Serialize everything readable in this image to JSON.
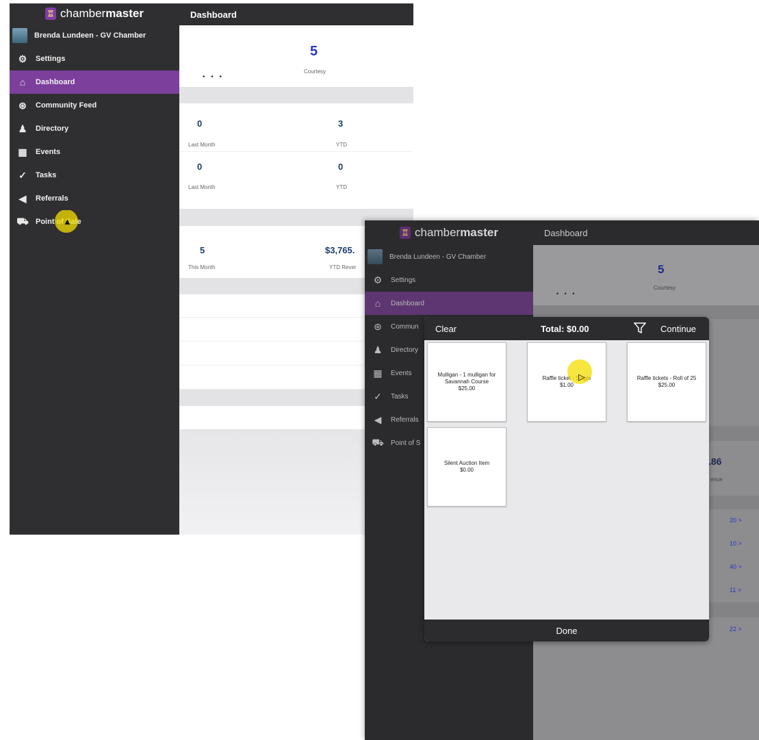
{
  "app": {
    "logo_text_a": "chamber",
    "logo_text_b": "master",
    "logo_glyph": "♖",
    "header_title": "Dashboard"
  },
  "sidebar": {
    "user": "Brenda Lundeen - GV Chamber",
    "items": [
      {
        "label": "Settings",
        "icon": "gear-icon",
        "glyph": "⚙"
      },
      {
        "label": "Dashboard",
        "icon": "home-icon",
        "glyph": "⌂"
      },
      {
        "label": "Community Feed",
        "icon": "broadcast-icon",
        "glyph": "⊛"
      },
      {
        "label": "Directory",
        "icon": "people-icon",
        "glyph": "♟"
      },
      {
        "label": "Events",
        "icon": "calendar-icon",
        "glyph": "▦"
      },
      {
        "label": "Tasks",
        "icon": "check-icon",
        "glyph": "✓"
      },
      {
        "label": "Referrals",
        "icon": "megaphone-icon",
        "glyph": "◀"
      },
      {
        "label": "Point of Sale",
        "icon": "cart-icon",
        "glyph": "🛒"
      }
    ],
    "screen2_items": [
      "Settings",
      "Dashboard",
      "Commun",
      "Directory",
      "Events",
      "Tasks",
      "Referrals",
      "Point of S"
    ]
  },
  "dashboard": {
    "courtesy_value": "5",
    "courtesy_label": "Courtesy",
    "row1": {
      "left_value": "0",
      "left_label": "Last Month",
      "right_value": "3",
      "right_label": "YTD"
    },
    "row2": {
      "left_value": "0",
      "left_label": "Last Month",
      "right_value": "0",
      "right_label": "YTD"
    },
    "row3": {
      "left_value": "5",
      "left_label": "This Month",
      "right_value": "$3,765.",
      "right_label": "YTD Rever"
    },
    "dots": "• • •"
  },
  "screen2_dashboard": {
    "partial_value": ".86",
    "partial_label": "enue",
    "list_counts": [
      "20 >",
      "10 >",
      "40 >",
      "11 >",
      "22 >"
    ]
  },
  "pos_modal": {
    "clear_label": "Clear",
    "total_label": "Total: $0.00",
    "continue_label": "Continue",
    "done_label": "Done",
    "products": [
      {
        "name": "Mulligan - 1 mulligan for Savannah Course",
        "price": "$25.00"
      },
      {
        "name": "Raffle ticket - Single",
        "price": "$1.00"
      },
      {
        "name": "Raffle tickets - Roll of 25",
        "price": "$25.00"
      },
      {
        "name": "Silent Auction Item",
        "price": "$0.00"
      }
    ]
  },
  "colors": {
    "sidebar_bg": "#2f2f31",
    "active_item": "#7d3f9c",
    "number_blue": "#2a36c9"
  }
}
